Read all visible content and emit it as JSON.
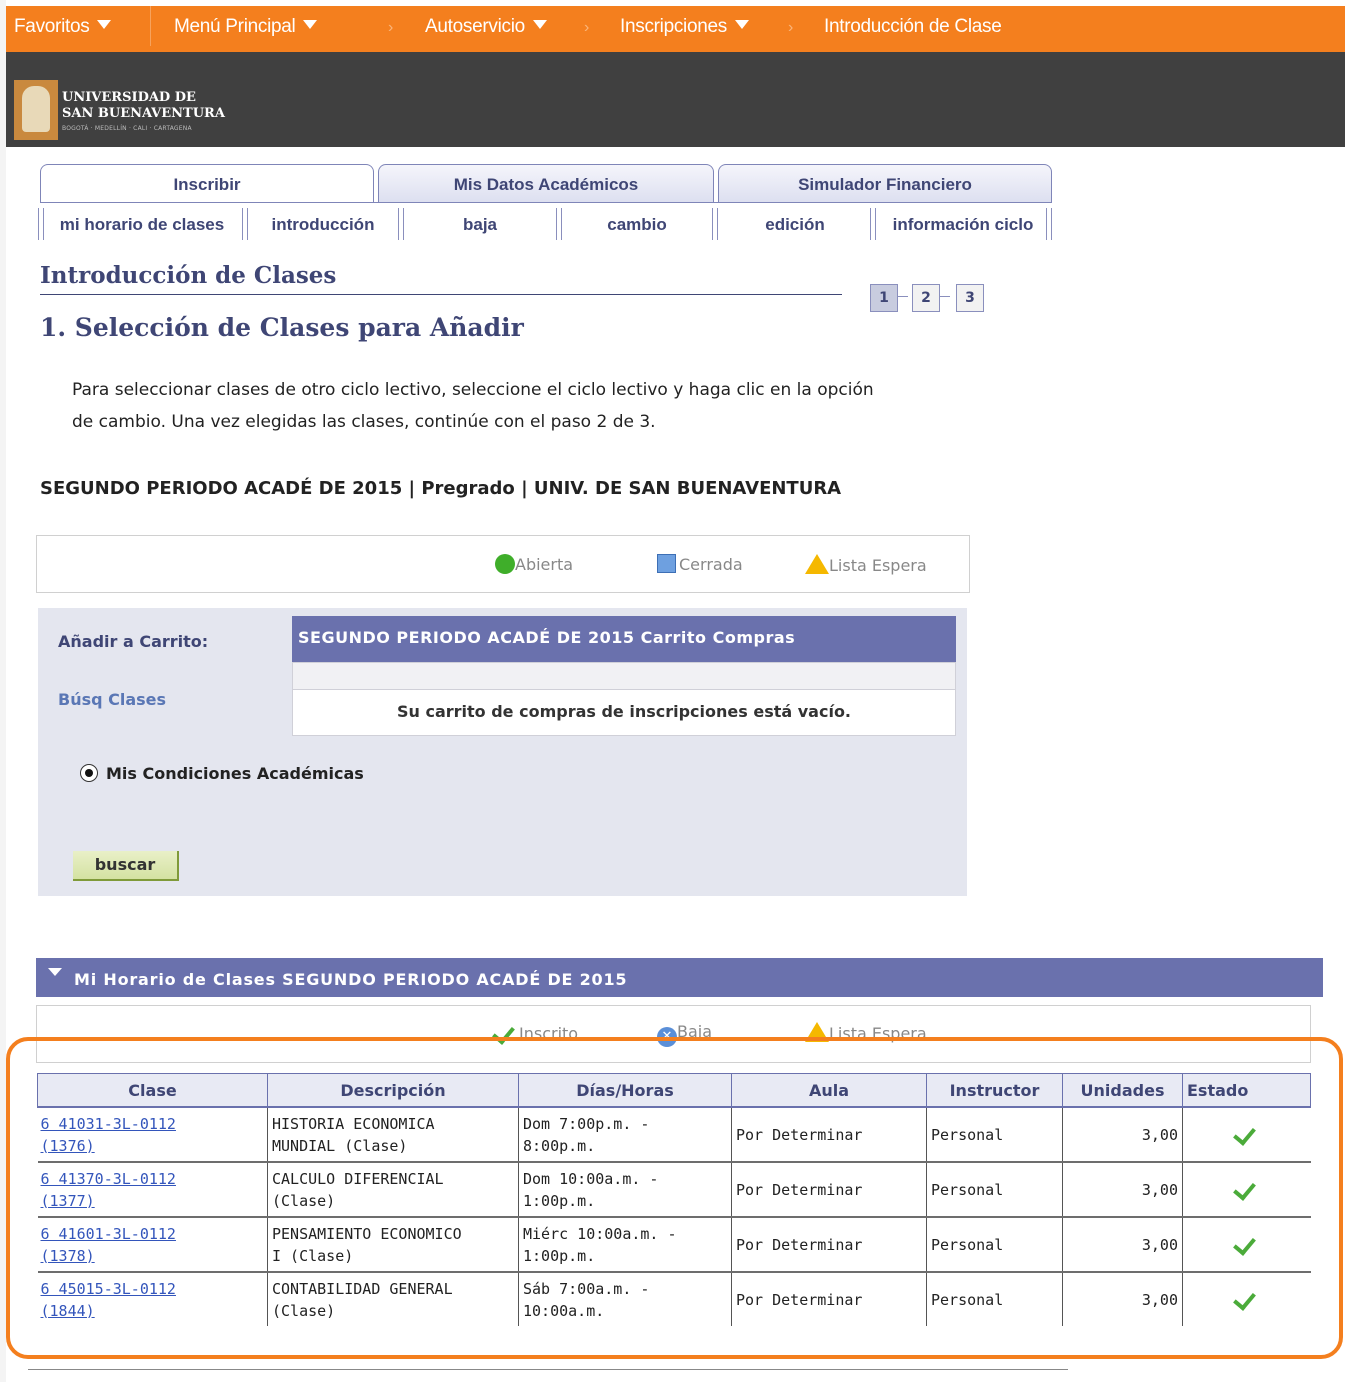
{
  "topnav": {
    "favorites": "Favoritos",
    "main_menu": "Menú Principal",
    "self_service": "Autoservicio",
    "enrollment": "Inscripciones",
    "current": "Introducción de Clase"
  },
  "logo": {
    "line1": "UNIVERSIDAD DE",
    "line2": "SAN BUENAVENTURA",
    "sub": "BOGOTÁ · MEDELLÍN · CALI · CARTAGENA"
  },
  "tabs": [
    "Inscribir",
    "Mis Datos Académicos",
    "Simulador Financiero"
  ],
  "subtabs": [
    "mi horario de clases",
    "introducción",
    "baja",
    "cambio",
    "edición",
    "información ciclo"
  ],
  "page_title": "Introducción de Clases",
  "steps": [
    "1",
    "2",
    "3"
  ],
  "section_title": "1. Selección de Clases para Añadir",
  "instructions_line1": "Para seleccionar clases de otro ciclo lectivo, seleccione el ciclo lectivo y haga clic en la opción",
  "instructions_line2": "de cambio. Una vez elegidas las clases, continúe con el paso 2 de 3.",
  "term_line": "SEGUNDO PERIODO ACADÉ DE 2015 | Pregrado | UNIV. DE SAN BUENAVENTURA",
  "legend1": {
    "open": "Abierta",
    "closed": "Cerrada",
    "waitlist": "Lista Espera"
  },
  "cart": {
    "add_label": "Añadir a Carrito:",
    "search_link": "Búsq Clases",
    "header": "SEGUNDO PERIODO ACADÉ DE 2015 Carrito Compras",
    "empty_msg": "Su carrito de compras de inscripciones está vacío.",
    "radio_label": "Mis Condiciones Académicas",
    "search_button": "buscar"
  },
  "schedule": {
    "title": "Mi Horario de Clases SEGUNDO PERIODO ACADÉ DE 2015",
    "legend": {
      "enrolled": "Inscrito",
      "dropped": "Baja",
      "waitlist": "Lista Espera"
    },
    "columns": [
      "Clase",
      "Descripción",
      "Días/Horas",
      "Aula",
      "Instructor",
      "Unidades",
      "Estado"
    ],
    "rows": [
      {
        "class_line1": "6 41031-3L-0112",
        "class_line2": "(1376)",
        "desc_line1": "HISTORIA ECONOMICA",
        "desc_line2": "MUNDIAL (Clase)",
        "time_line1": "Dom 7:00p.m. -",
        "time_line2": "8:00p.m.",
        "room": "Por Determinar",
        "instructor": "Personal",
        "units": "3,00"
      },
      {
        "class_line1": "6 41370-3L-0112",
        "class_line2": "(1377)",
        "desc_line1": "CALCULO DIFERENCIAL",
        "desc_line2": "(Clase)",
        "time_line1": "Dom 10:00a.m. -",
        "time_line2": "1:00p.m.",
        "room": "Por Determinar",
        "instructor": "Personal",
        "units": "3,00"
      },
      {
        "class_line1": "6 41601-3L-0112",
        "class_line2": "(1378)",
        "desc_line1": "PENSAMIENTO ECONOMICO",
        "desc_line2": "I (Clase)",
        "time_line1": "Miérc 10:00a.m. -",
        "time_line2": "1:00p.m.",
        "room": "Por Determinar",
        "instructor": "Personal",
        "units": "3,00"
      },
      {
        "class_line1": "6 45015-3L-0112",
        "class_line2": "(1844)",
        "desc_line1": "CONTABILIDAD GENERAL",
        "desc_line2": "(Clase)",
        "time_line1": "Sáb 7:00a.m. -",
        "time_line2": "10:00a.m.",
        "room": "Por Determinar",
        "instructor": "Personal",
        "units": "3,00"
      }
    ]
  },
  "colors": {
    "nav": "#f47f1e",
    "banner": "#404040",
    "header_blue": "#6a71ad",
    "title_blue": "#3f4675"
  }
}
